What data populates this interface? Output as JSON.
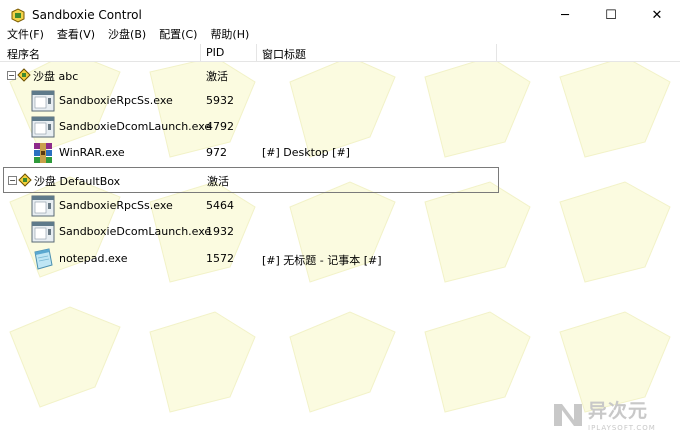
{
  "window": {
    "title": "Sandboxie Control",
    "controls": {
      "minimize": "─",
      "maximize": "☐",
      "close": "✕"
    }
  },
  "menu": [
    "文件(F)",
    "查看(V)",
    "沙盘(B)",
    "配置(C)",
    "帮助(H)"
  ],
  "columns": {
    "name": "程序名",
    "pid": "PID",
    "window_title": "窗口标题"
  },
  "rows": [
    {
      "type": "sandbox",
      "name": "沙盘 abc",
      "pid": "激活",
      "window_title": ""
    },
    {
      "type": "process",
      "icon": "generic-exe-icon",
      "name": "SandboxieRpcSs.exe",
      "pid": "5932",
      "window_title": ""
    },
    {
      "type": "process",
      "icon": "generic-exe-icon",
      "name": "SandboxieDcomLaunch.exe",
      "pid": "4792",
      "window_title": ""
    },
    {
      "type": "process",
      "icon": "winrar-icon",
      "name": "WinRAR.exe",
      "pid": "972",
      "window_title": "[#] Desktop [#]"
    },
    {
      "type": "sandbox",
      "name": "沙盘 DefaultBox",
      "pid": "激活",
      "window_title": ""
    },
    {
      "type": "process",
      "icon": "generic-exe-icon",
      "name": "SandboxieRpcSs.exe",
      "pid": "5464",
      "window_title": ""
    },
    {
      "type": "process",
      "icon": "generic-exe-icon",
      "name": "SandboxieDcomLaunch.exe",
      "pid": "1932",
      "window_title": ""
    },
    {
      "type": "process",
      "icon": "notepad-icon",
      "name": "notepad.exe",
      "pid": "1572",
      "window_title": "[#] 无标题 - 记事本 [#]"
    }
  ],
  "watermark": {
    "text": "异次元",
    "subtext": "IPLAYSOFT.COM"
  },
  "colors": {
    "background_shape": "#fbfbe0",
    "expander_border": "#808080"
  }
}
